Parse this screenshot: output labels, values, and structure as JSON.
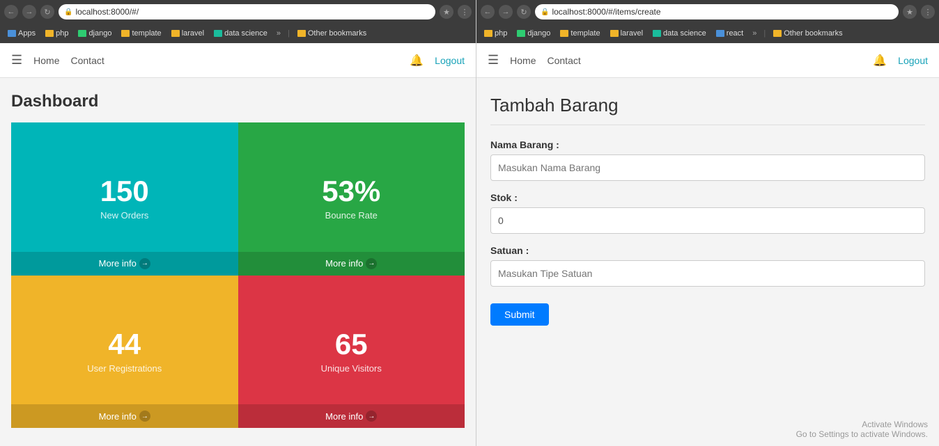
{
  "left": {
    "browser": {
      "url": "localhost:8000/#/",
      "bookmarks": [
        "Apps",
        "php",
        "django",
        "template",
        "laravel",
        "data science"
      ],
      "other_bookmarks": "Other bookmarks"
    },
    "nav": {
      "home": "Home",
      "contact": "Contact",
      "logout": "Logout"
    },
    "dashboard": {
      "title": "Dashboard",
      "cards": [
        {
          "value": "150",
          "label": "New Orders",
          "more_info": "More info",
          "color": "teal"
        },
        {
          "value": "53%",
          "label": "Bounce Rate",
          "more_info": "More info",
          "color": "green"
        },
        {
          "value": "44",
          "label": "User Registrations",
          "more_info": "More info",
          "color": "yellow"
        },
        {
          "value": "65",
          "label": "Unique Visitors",
          "more_info": "More info",
          "color": "red"
        }
      ]
    }
  },
  "right": {
    "browser": {
      "url": "localhost:8000/#/items/create",
      "bookmarks": [
        "php",
        "django",
        "template",
        "laravel",
        "data science",
        "react"
      ],
      "other_bookmarks": "Other bookmarks"
    },
    "nav": {
      "home": "Home",
      "contact": "Contact",
      "logout": "Logout"
    },
    "form": {
      "title": "Tambah Barang",
      "nama_label": "Nama Barang :",
      "nama_placeholder": "Masukan Nama Barang",
      "stok_label": "Stok :",
      "stok_value": "0",
      "satuan_label": "Satuan :",
      "satuan_placeholder": "Masukan Tipe Satuan",
      "submit": "Submit"
    },
    "watermark_line1": "Activate Windows",
    "watermark_line2": "Go to Settings to activate Windows."
  }
}
